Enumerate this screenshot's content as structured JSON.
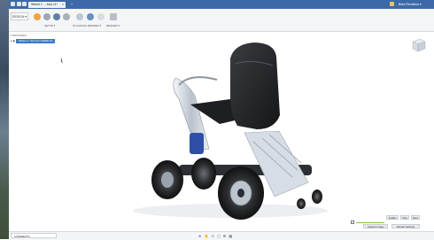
{
  "app": {
    "doc_tab": "Wheel 1 ... lock v1*",
    "tab_close": "×",
    "titlebar_right": "Beta Rendition ▾",
    "tab_counter": "1 of 1"
  },
  "toolbar": {
    "design_label": "DESIGN ▾",
    "groups": [
      {
        "label": "SETUP ▾"
      },
      {
        "label": "IN-CANVAS RENDER ▾"
      },
      {
        "label": "RENDER ▾"
      }
    ]
  },
  "browser": {
    "header": "BROWSER",
    "root_item": "Wheel 1 / Tor Form WIDE 1b"
  },
  "bottom": {
    "comments": "COMMENTS",
    "nav_icons": "⊕ ✋ ⊙ ▢ ⊞ ▦"
  },
  "render_panel": {
    "btn1": "Quality",
    "btn2": "Stop",
    "btn3": "Save",
    "btn4": "Capture Image",
    "btn5": "Render Settings"
  },
  "colors": {
    "titlebar": "#3c6aa8",
    "toolbar": "#f4f5f6",
    "selection": "#3d7ac9",
    "progress": "#7ac943"
  }
}
